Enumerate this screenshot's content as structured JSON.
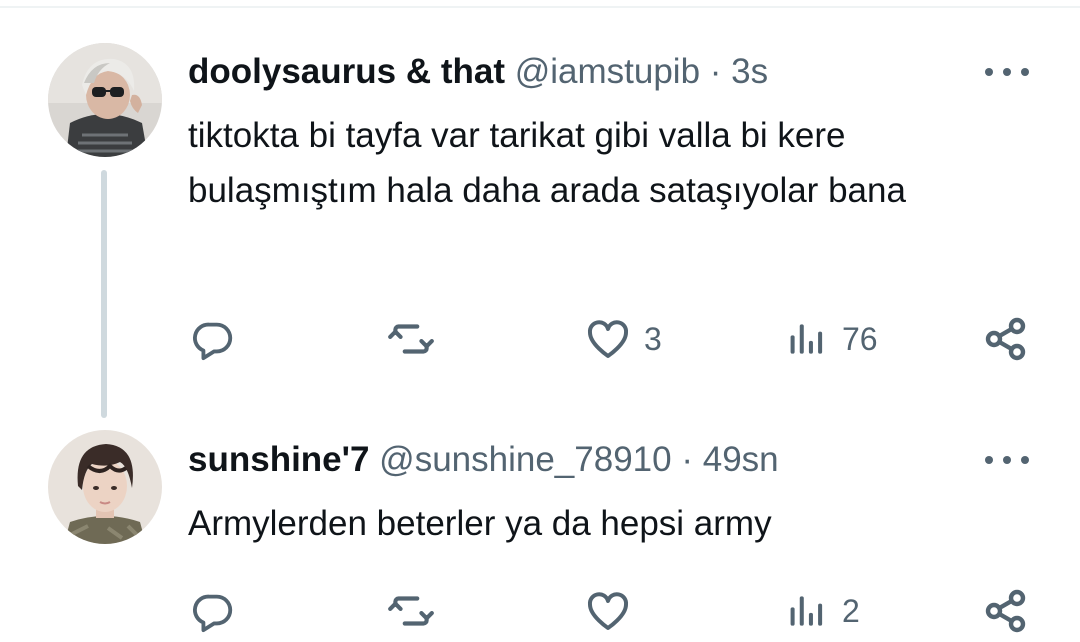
{
  "tweets": [
    {
      "display_name": "doolysaurus & that",
      "handle": "@iamstupib",
      "separator": "·",
      "time": "3s",
      "text": "tiktokta bi tayfa var tarikat gibi valla bi kere bulaşmıştım hala daha arada sataşıyolar bana",
      "reply_count": "",
      "repost_count": "",
      "like_count": "3",
      "view_count": "76"
    },
    {
      "display_name": "sunshine'7",
      "handle": "@sunshine_78910",
      "separator": "·",
      "time": "49sn",
      "text": "Armylerden beterler ya da hepsi army",
      "reply_count": "",
      "repost_count": "",
      "like_count": "",
      "view_count": "2"
    }
  ],
  "icons": {
    "reply": "reply-icon",
    "repost": "repost-icon",
    "like": "heart-icon",
    "views": "views-icon",
    "share": "share-icon",
    "more": "more-icon"
  },
  "colors": {
    "text": "#0f1419",
    "secondary": "#536471",
    "thread_line": "#cfd9de"
  }
}
